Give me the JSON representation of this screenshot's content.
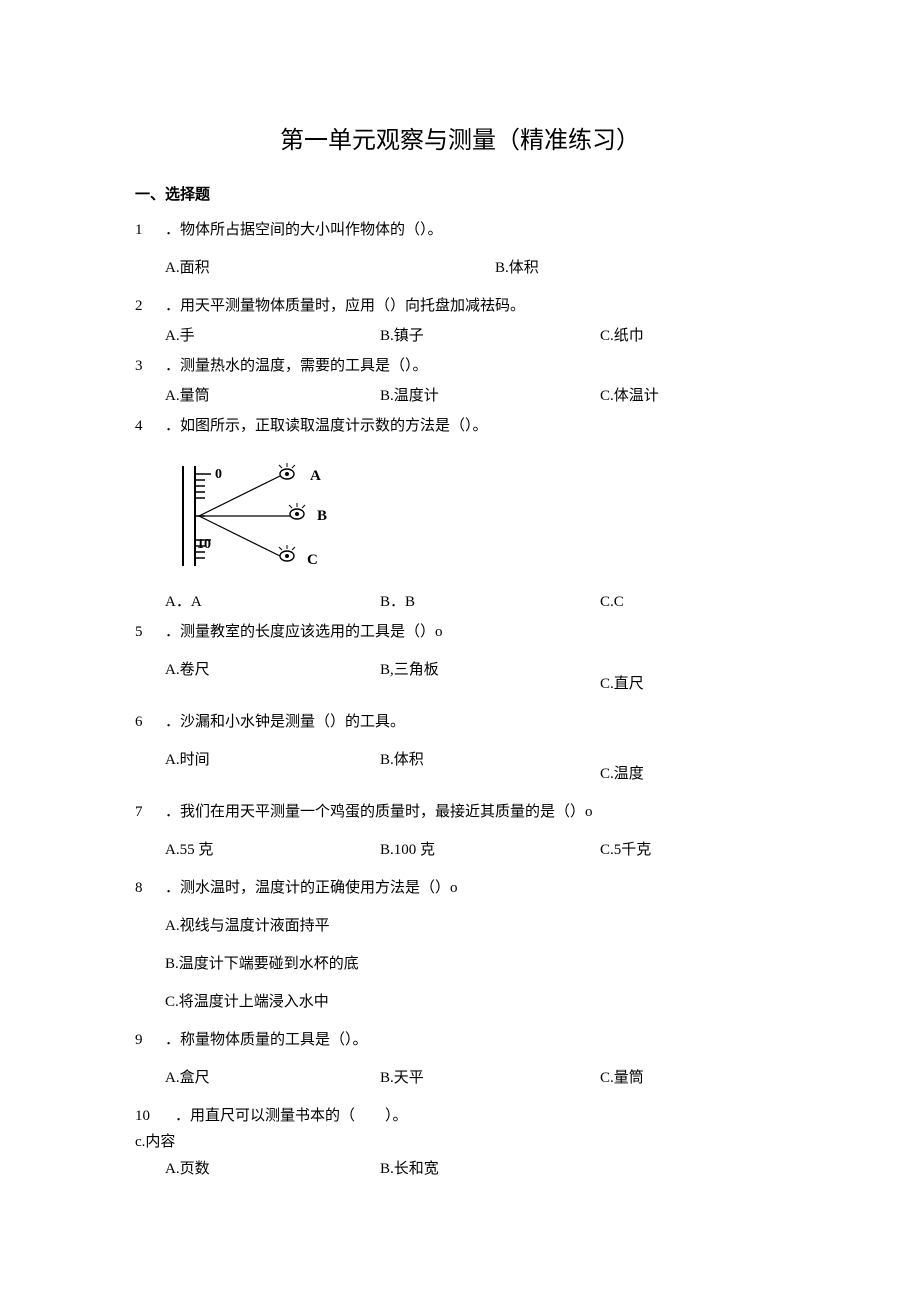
{
  "title": "第一单元观察与测量（精准练习）",
  "section": "一、选择题",
  "q1": {
    "num": "1",
    "text": "．物体所占据空间的大小叫作物体的（）。",
    "a": "A.面积",
    "b": "B.体积"
  },
  "q2": {
    "num": "2",
    "text": "．用天平测量物体质量时，应用（）向托盘加减祛码。",
    "a": "A.手",
    "b": "B.镇子",
    "c": "C.纸巾"
  },
  "q3": {
    "num": "3",
    "text": "．测量热水的温度，需要的工具是（）。",
    "a": "A.量筒",
    "b": "B.温度计",
    "c": "C.体温计"
  },
  "q4": {
    "num": "4",
    "text": "．如图所示，正取读取温度计示数的方法是（）。",
    "a": "A．A",
    "b": "B．B",
    "c": "C.C",
    "fig": {
      "top": "0",
      "bottom": "10",
      "A": "A",
      "B": "B",
      "C": "C"
    }
  },
  "q5": {
    "num": "5",
    "text": "．测量教室的长度应该选用的工具是（）o",
    "a": "A.卷尺",
    "b": "B,三角板",
    "c": "C.直尺"
  },
  "q6": {
    "num": "6",
    "text": "．沙漏和小水钟是测量（）的工具。",
    "a": "A.时间",
    "b": "B.体积",
    "c": "C.温度"
  },
  "q7": {
    "num": "7",
    "text": "．我们在用天平测量一个鸡蛋的质量时，最接近其质量的是（）o",
    "a": "A.55 克",
    "b": "B.100 克",
    "c": "C.5千克"
  },
  "q8": {
    "num": "8",
    "text": "．测水温时，温度计的正确使用方法是（）o",
    "a": "A.视线与温度计液面持平",
    "b": "B.温度计下端要碰到水杯的底",
    "c": "C.将温度计上端浸入水中"
  },
  "q9": {
    "num": "9",
    "text": "．称量物体质量的工具是（）。",
    "a": "A.盒尺",
    "b": "B.天平",
    "c": "C.量筒"
  },
  "q10": {
    "num": "10",
    "text": "．用直尺可以测量书本的（　　）。",
    "a": "A.页数",
    "b": "B.长和宽",
    "cstray": "c.内容"
  }
}
